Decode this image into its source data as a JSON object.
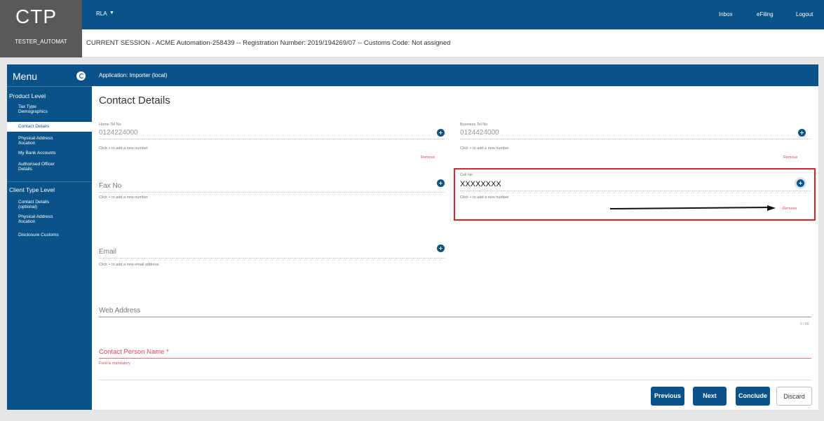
{
  "logo": {
    "text": "CTP",
    "user": "TESTER_AUTOMAT"
  },
  "topbar": {
    "dropdown": "RLA",
    "caret": "▼",
    "links": [
      "Inbox",
      "eFiling",
      "Logout"
    ]
  },
  "session": {
    "text": "CURRENT SESSION - ACME Automation-258439 -- Registration Number: 2019/194269/07 -- Customs Code: Not assigned"
  },
  "sidebar": {
    "title": "Menu",
    "sections": [
      {
        "label": "Product Level",
        "items": [
          "Tax Type Demographics",
          "Contact Details",
          "Physical Address /location",
          "My Bank Accounts",
          "Authorised Officer Details"
        ]
      },
      {
        "label": "Client Type Level",
        "items": [
          "Contact Details (optional)",
          "Physical Address /location",
          "Disclosure Customs"
        ]
      }
    ],
    "active_item": "Contact Details"
  },
  "main": {
    "appbar": "Application: Importer (local)",
    "title": "Contact Details",
    "home_tel": {
      "label": "Home Tel No",
      "value": "0124224000",
      "hint": "Click + to add a new number",
      "remove": "Remove"
    },
    "business_tel": {
      "label": "Business Tel No",
      "value": "0124424000",
      "hint": "Click + to add a new number",
      "remove": "Remove"
    },
    "fax": {
      "placeholder": "Fax No",
      "hint": "Click + to add a new number"
    },
    "cell": {
      "label": "Cell No",
      "value": "XXXXXXXX",
      "hint": "Click + to add a new number",
      "remove": "Remove"
    },
    "email": {
      "placeholder": "Email",
      "hint": "Click + to add a new email address"
    },
    "web": {
      "placeholder": "Web Address",
      "counter": "0 / 80"
    },
    "contact_person": {
      "placeholder": "Contact Person Name *",
      "hint": "Field is mandatory"
    },
    "buttons": {
      "previous": "Previous",
      "next": "Next",
      "conclude": "Conclude",
      "discard": "Discard"
    }
  },
  "colors": {
    "brand": "#0a5389",
    "highlight": "#d9252f",
    "error": "#e04a55"
  }
}
